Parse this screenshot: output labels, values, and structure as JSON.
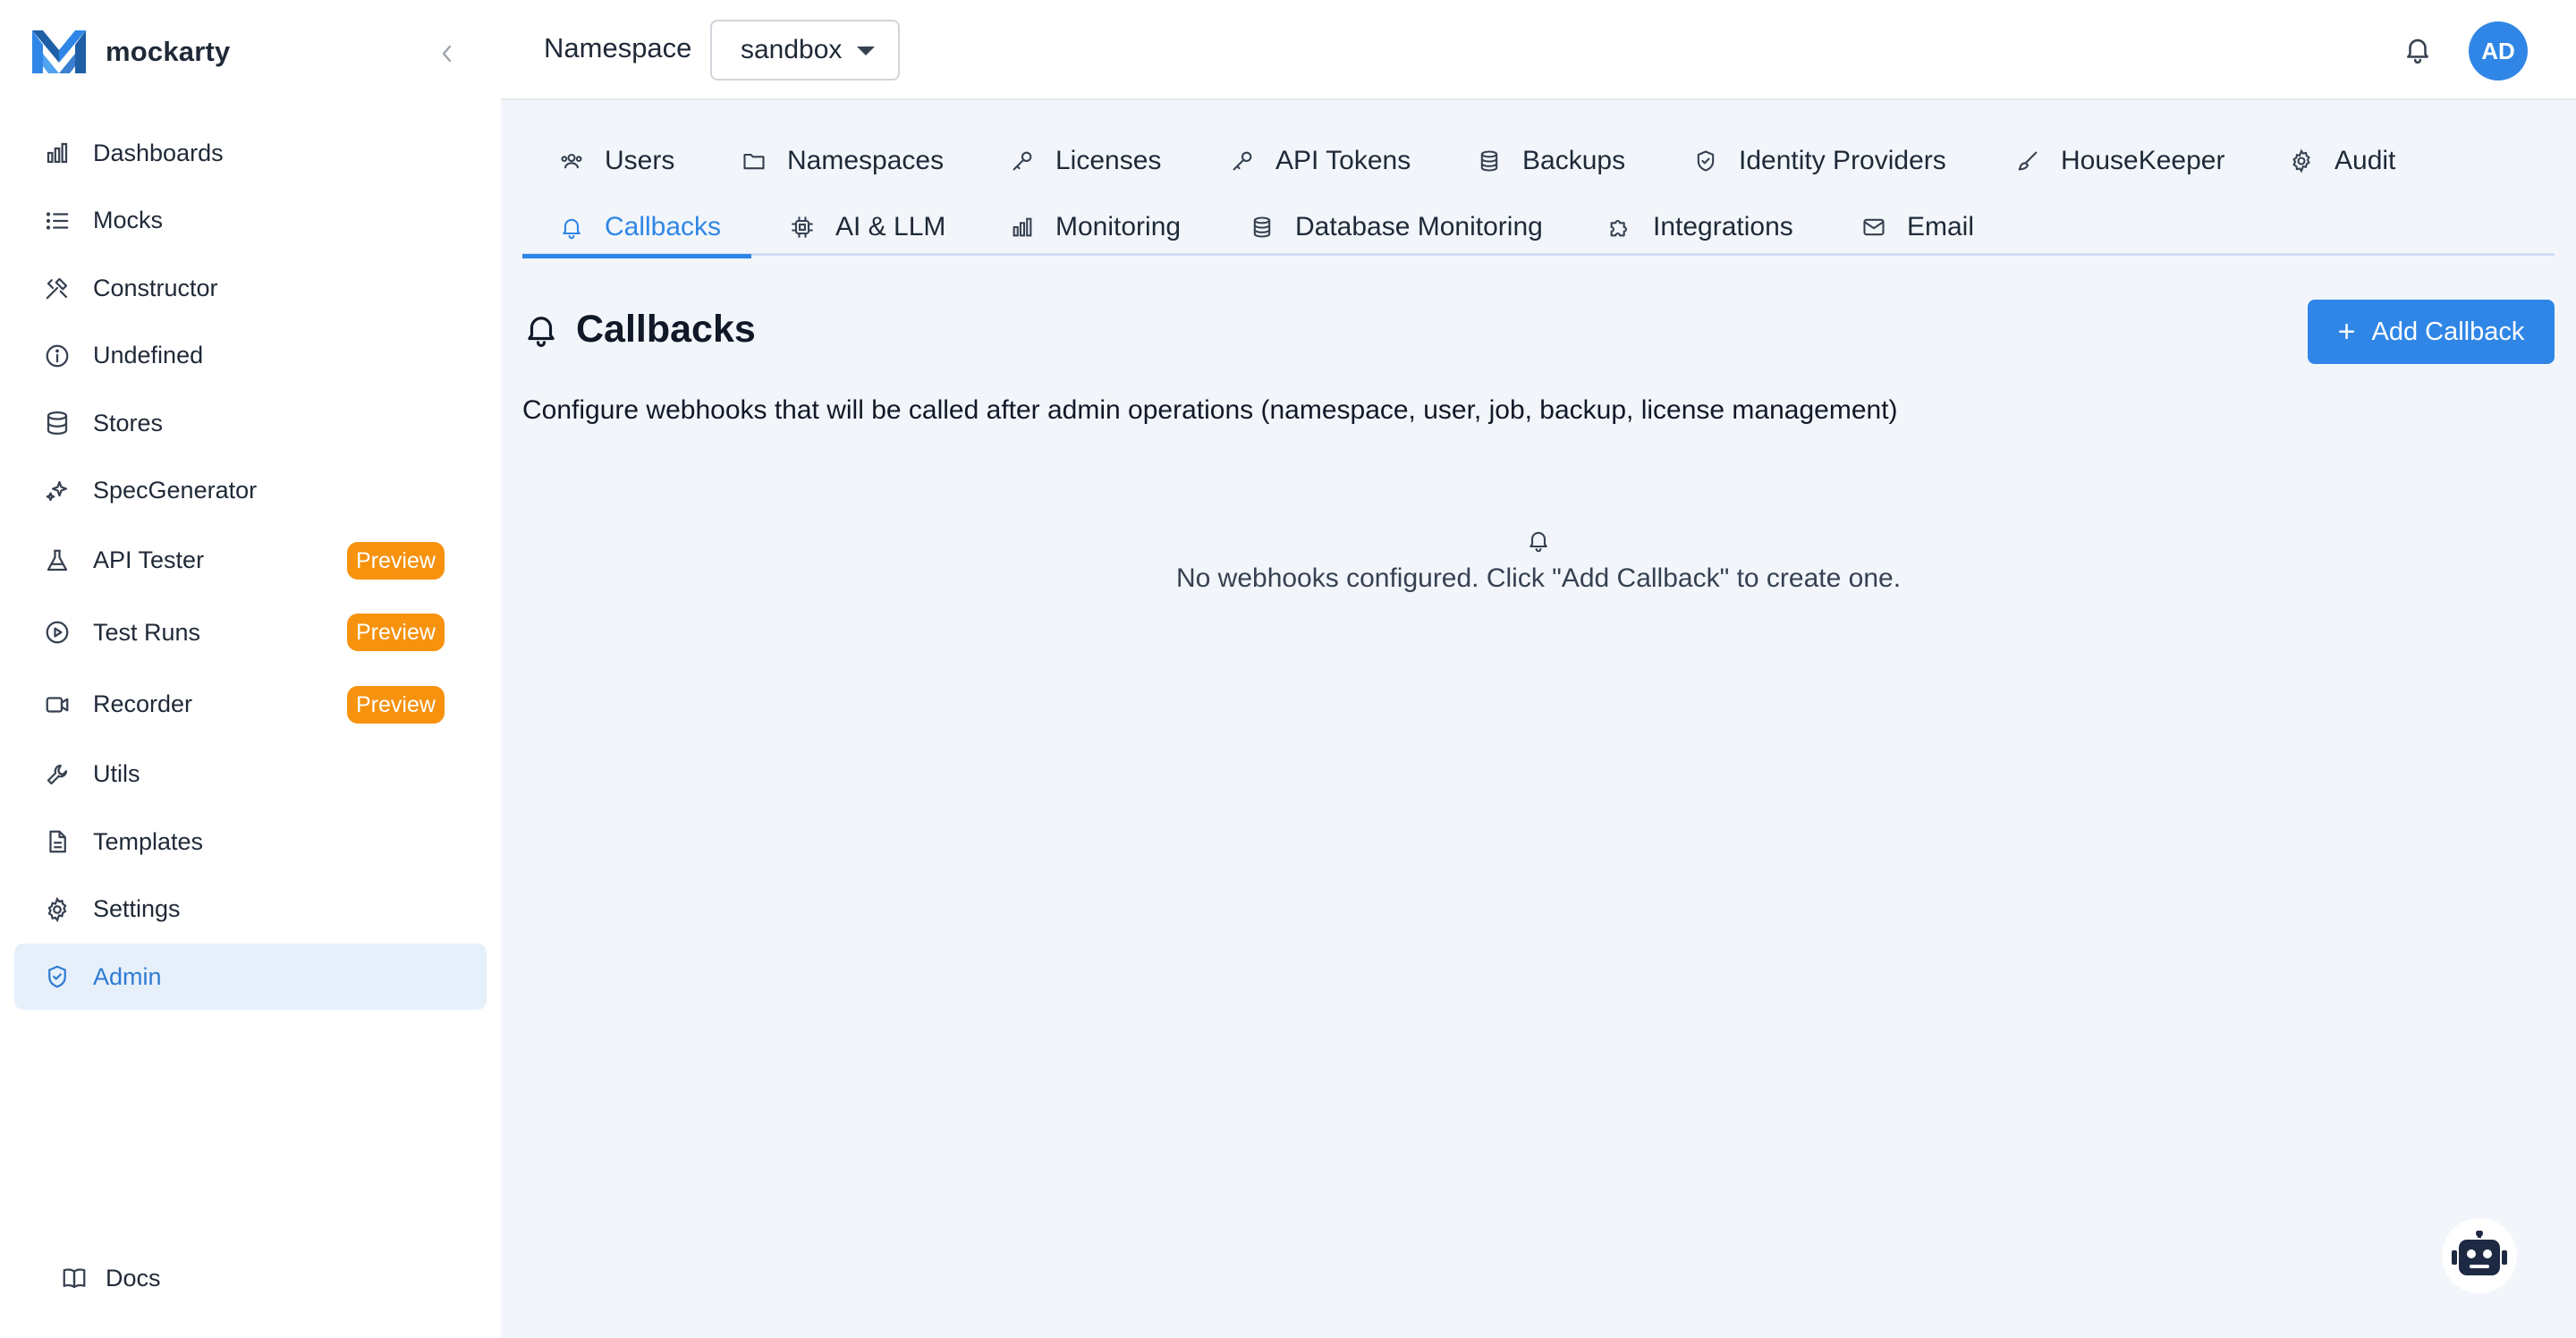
{
  "brand": {
    "name": "mockarty"
  },
  "sidebar": {
    "items": [
      {
        "label": "Dashboards",
        "icon": "bar-chart-icon"
      },
      {
        "label": "Mocks",
        "icon": "list-icon"
      },
      {
        "label": "Constructor",
        "icon": "tools-icon"
      },
      {
        "label": "Undefined",
        "icon": "info-icon"
      },
      {
        "label": "Stores",
        "icon": "database-icon"
      },
      {
        "label": "SpecGenerator",
        "icon": "sparkles-icon"
      },
      {
        "label": "API Tester",
        "icon": "flask-icon",
        "badge": "Preview"
      },
      {
        "label": "Test Runs",
        "icon": "play-circle-icon",
        "badge": "Preview"
      },
      {
        "label": "Recorder",
        "icon": "video-icon",
        "badge": "Preview"
      },
      {
        "label": "Utils",
        "icon": "wrench-icon"
      },
      {
        "label": "Templates",
        "icon": "file-icon"
      },
      {
        "label": "Settings",
        "icon": "gear-icon"
      },
      {
        "label": "Admin",
        "icon": "shield-icon",
        "active": true
      }
    ],
    "docs_label": "Docs"
  },
  "header": {
    "namespace_label": "Namespace",
    "namespace_value": "sandbox",
    "avatar_initials": "AD"
  },
  "tabs": {
    "row1": [
      "Users",
      "Namespaces",
      "Licenses",
      "API Tokens",
      "Backups",
      "Identity Providers",
      "HouseKeeper",
      "Audit"
    ],
    "row2": [
      "Callbacks",
      "AI & LLM",
      "Monitoring",
      "Database Monitoring",
      "Integrations",
      "Email"
    ],
    "active": "Callbacks"
  },
  "page": {
    "title": "Callbacks",
    "add_button": "Add Callback",
    "description": "Configure webhooks that will be called after admin operations (namespace, user, job, backup, license management)",
    "empty_message": "No webhooks configured. Click \"Add Callback\" to create one."
  },
  "colors": {
    "accent": "#2f86e6",
    "badge": "#f7920f",
    "active_bg": "#e6f0fb",
    "main_bg": "#f2f6fb"
  }
}
